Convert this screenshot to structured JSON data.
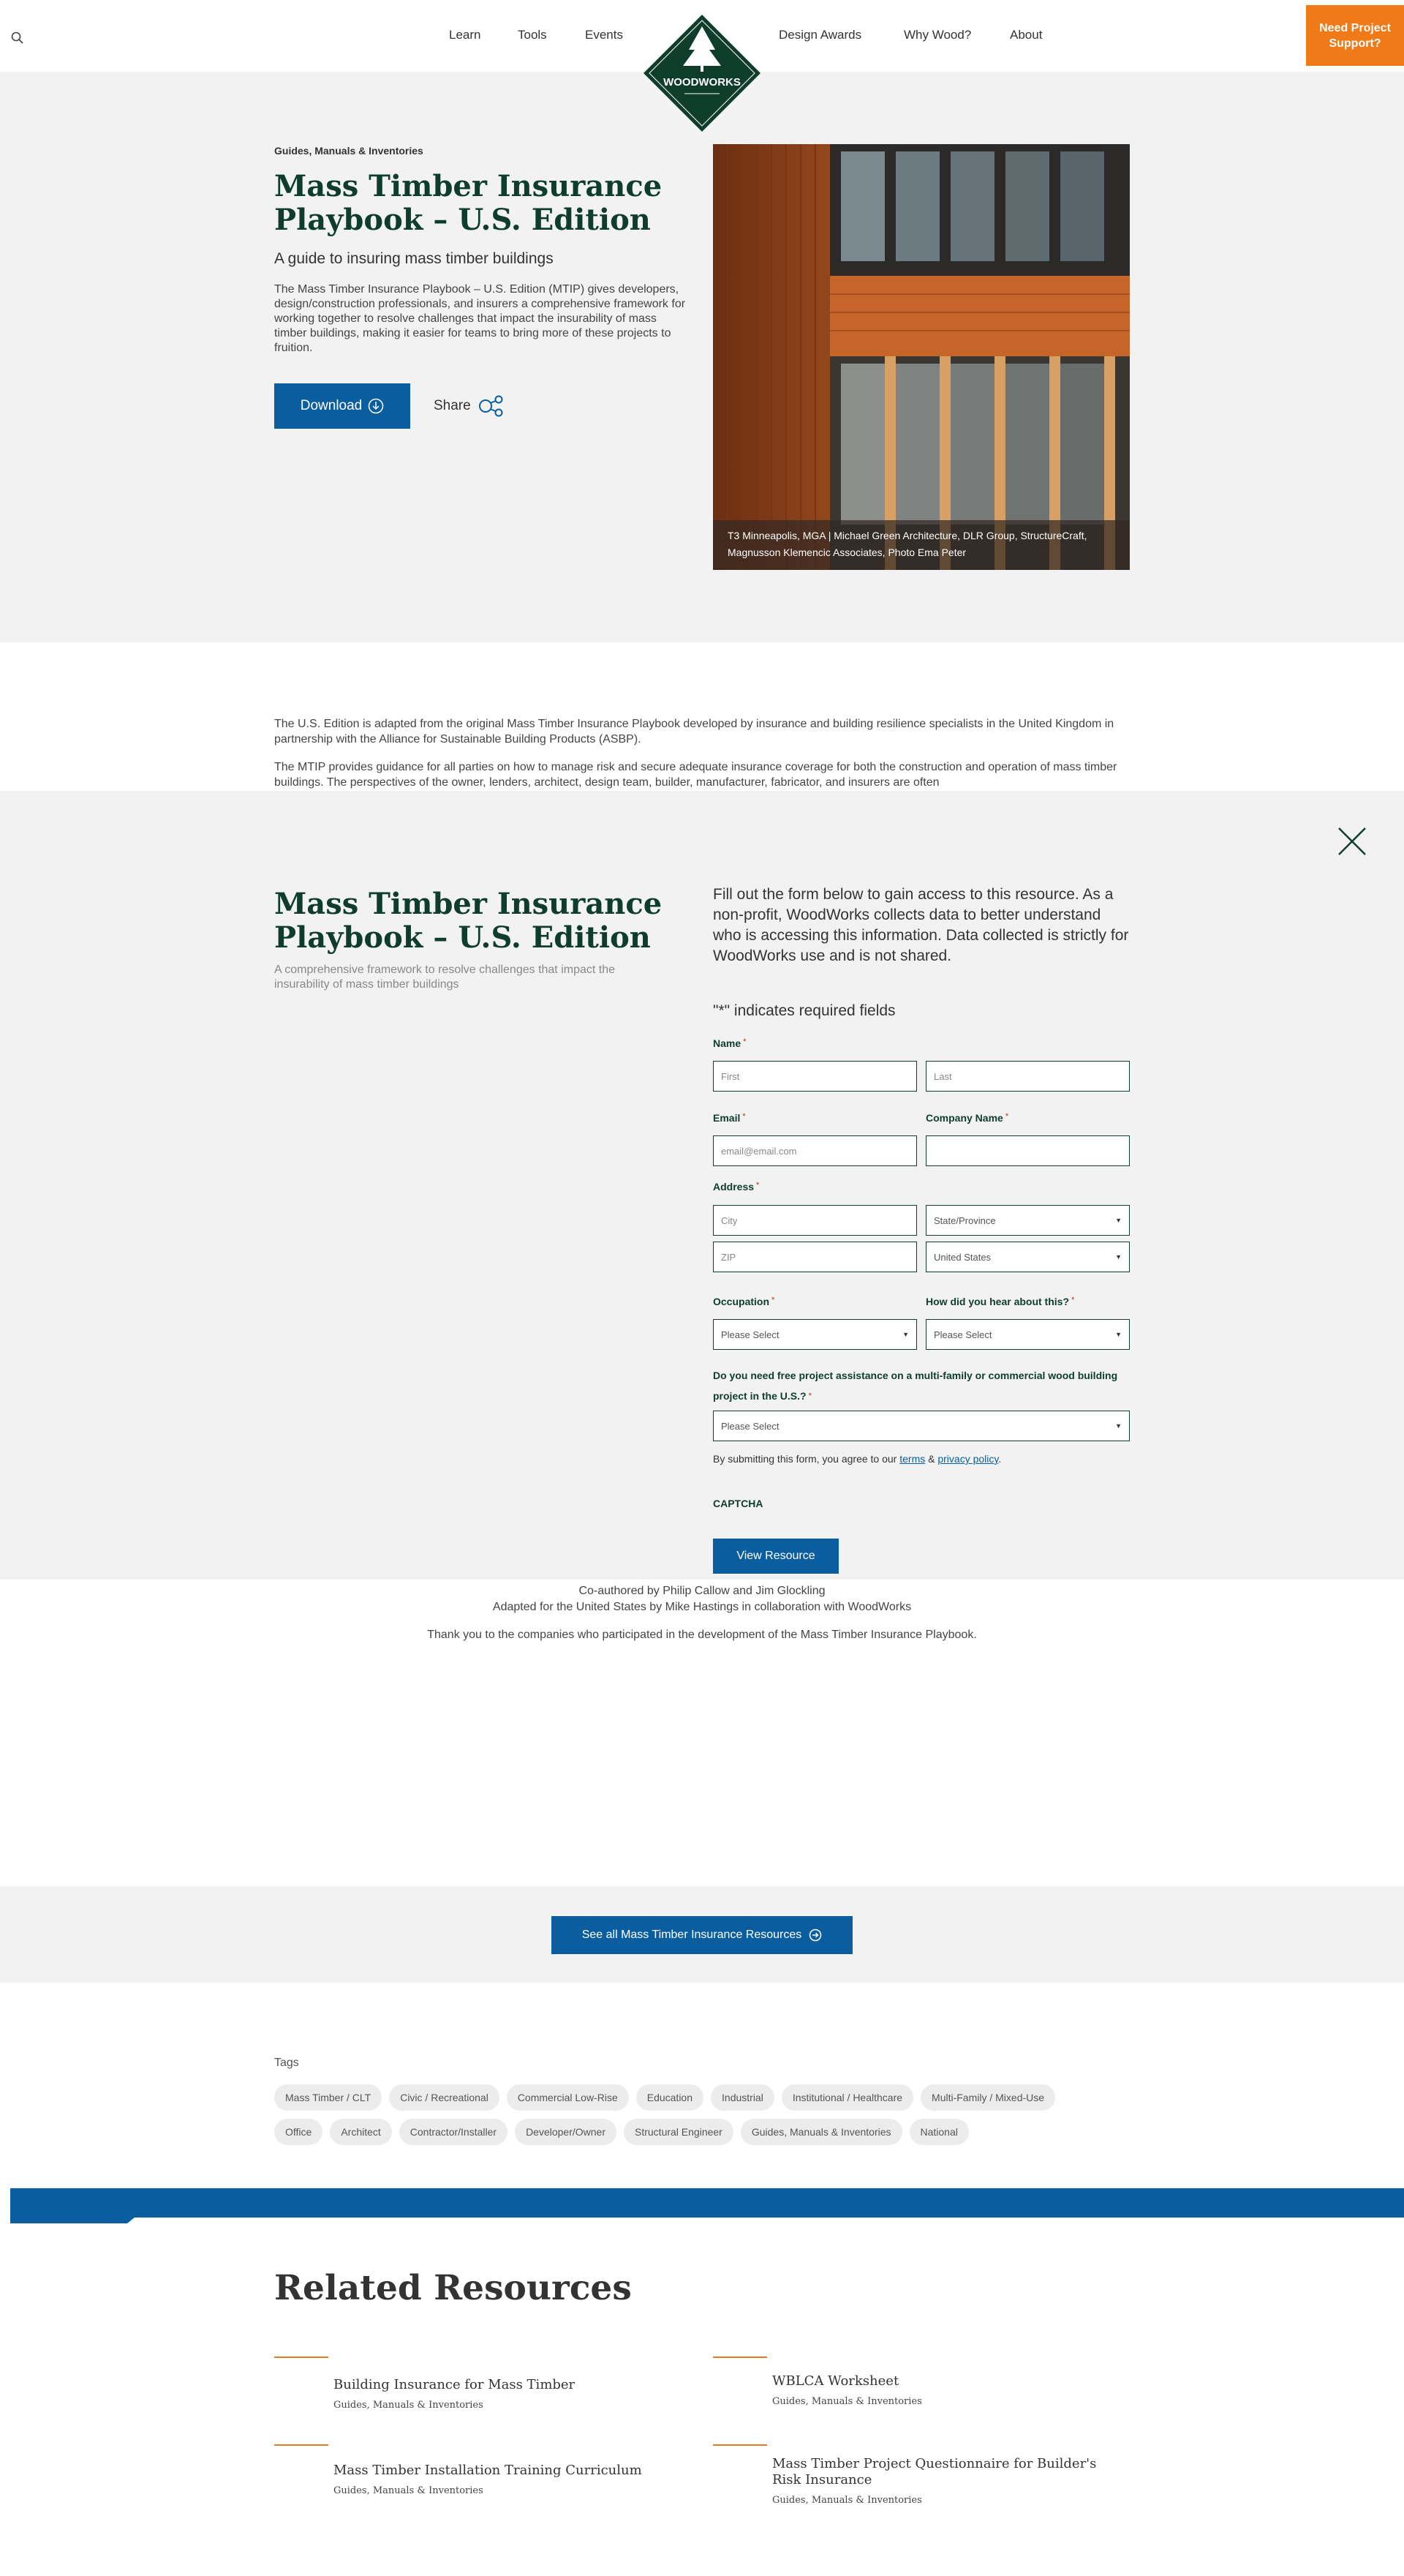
{
  "header": {
    "nav": [
      "Learn",
      "Tools",
      "Events",
      "Design Awards",
      "Why Wood?",
      "About"
    ],
    "logo_text": "WOODWORKS",
    "cta_label": "Need Project Support?"
  },
  "hero": {
    "eyebrow": "Guides, Manuals & Inventories",
    "title": "Mass Timber Insurance Playbook – U.S. Edition",
    "subtitle": "A guide to insuring mass timber buildings",
    "description": "The Mass Timber Insurance Playbook – U.S. Edition (MTIP) gives developers, design/construction professionals, and insurers a comprehensive framework for working together to resolve challenges that impact the insurability of mass timber buildings, making it easier for teams to bring more of these projects to fruition.",
    "download_label": "Download",
    "share_label": "Share",
    "photo_caption": "T3 Minneapolis, MGA | Michael Green Architecture, DLR Group, StructureCraft, Magnusson Klemencic Associates, Photo Ema Peter"
  },
  "body": {
    "p1": "The U.S. Edition is adapted from the original Mass Timber Insurance Playbook developed by insurance and building resilience specialists in the United Kingdom in partnership with the Alliance for Sustainable Building Products (ASBP).",
    "p2": "The MTIP provides guidance for all parties on how to manage risk and secure adequate insurance coverage for both the construction and operation of mass timber buildings. The perspectives of the owner, lenders, architect, design team, builder, manufacturer, fabricator, and insurers are often"
  },
  "modal": {
    "title": "Mass Timber Insurance Playbook – U.S. Edition",
    "subtitle": "A comprehensive framework to resolve challenges that impact the insurability of mass timber buildings",
    "intro": "Fill out the form below to gain access to this resource. As a non-profit, WoodWorks collects data to better understand who is accessing this information. Data collected is strictly for WoodWorks use and is not shared.",
    "required_note": "\"*\" indicates required fields",
    "name_label": "Name",
    "first_placeholder": "First",
    "last_placeholder": "Last",
    "email_label": "Email",
    "email_placeholder": "email@email.com",
    "company_label": "Company Name",
    "address_label": "Address",
    "city_placeholder": "City",
    "state_value": "State/Province",
    "zip_placeholder": "ZIP",
    "country_value": "United States",
    "occupation_label": "Occupation",
    "occupation_value": "Please Select",
    "hear_label": "How did you hear about this?",
    "hear_value": "Please Select",
    "assist_label": "Do you need free project assistance on a multi-family or commercial wood building project in the U.S.?",
    "assist_value": "Please Select",
    "terms_prefix": "By submitting this form, you agree to our",
    "terms_link": "terms",
    "terms_amp": "&",
    "privacy_link": "privacy policy",
    "terms_suffix": ".",
    "captcha_label": "CAPTCHA",
    "submit_label": "View Resource",
    "required_star": "*"
  },
  "credits": {
    "line1": "Co-authored by Philip Callow and Jim Glockling",
    "line2": "Adapted for the United States by Mike Hastings in collaboration with WoodWorks",
    "line3": "Thank you to the companies who participated in the development of the Mass Timber Insurance Playbook."
  },
  "see_all_label": "See all Mass Timber Insurance Resources",
  "tags": {
    "label": "Tags",
    "row1": [
      "Mass Timber / CLT",
      "Civic / Recreational",
      "Commercial Low-Rise",
      "Education",
      "Industrial",
      "Institutional / Healthcare",
      "Multi-Family / Mixed-Use"
    ],
    "row2": [
      "Office",
      "Architect",
      "Contractor/Installer",
      "Developer/Owner",
      "Structural Engineer",
      "Guides, Manuals & Inventories",
      "National"
    ]
  },
  "related": {
    "title": "Related Resources",
    "items": [
      {
        "name": "Building Insurance for Mass Timber",
        "category": "Guides, Manuals & Inventories"
      },
      {
        "name": "WBLCA Worksheet",
        "category": "Guides, Manuals & Inventories"
      },
      {
        "name": "Mass Timber Installation Training Curriculum",
        "category": "Guides, Manuals & Inventories"
      },
      {
        "name": "Mass Timber Project Questionnaire for Builder's Risk Insurance",
        "category": "Guides, Manuals & Inventories"
      }
    ]
  },
  "colors": {
    "brand_green": "#0e3d2b",
    "brand_blue": "#0a5ea0",
    "cta_orange": "#f07a17",
    "accent_orange": "#e07a2b"
  }
}
